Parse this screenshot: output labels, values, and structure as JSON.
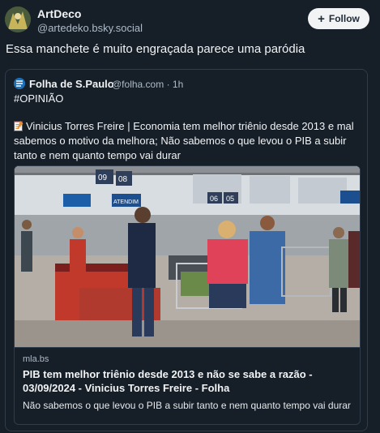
{
  "post": {
    "author": {
      "display_name": "ArtDeco",
      "handle": "@artedeko.bsky.social"
    },
    "follow_label": "Follow",
    "text": "Essa manchete é muito engraçada parece uma paródia"
  },
  "quote": {
    "author": {
      "display_name": "Folha de S.Paulo",
      "handle": "@folha.com",
      "time": "· 1h"
    },
    "tag": "#OPINIÃO",
    "text": "Vinicius Torres Freire | Economia tem melhor triênio desde 2013 e mal sabemos o motivo da melhora; Não sabemos o que levou o PIB a subir tanto e nem quanto tempo vai durar",
    "card": {
      "domain": "mla.bs",
      "title": "PIB tem melhor triênio desde 2013 e não se sabe a razão - 03/09/2024 - Vinicius Torres Freire - Folha",
      "description": "Não sabemos o que levou o PIB a subir tanto e nem quanto tempo vai durar",
      "image_signs": [
        "09",
        "08",
        "ATENDIM",
        "06",
        "05"
      ]
    }
  }
}
